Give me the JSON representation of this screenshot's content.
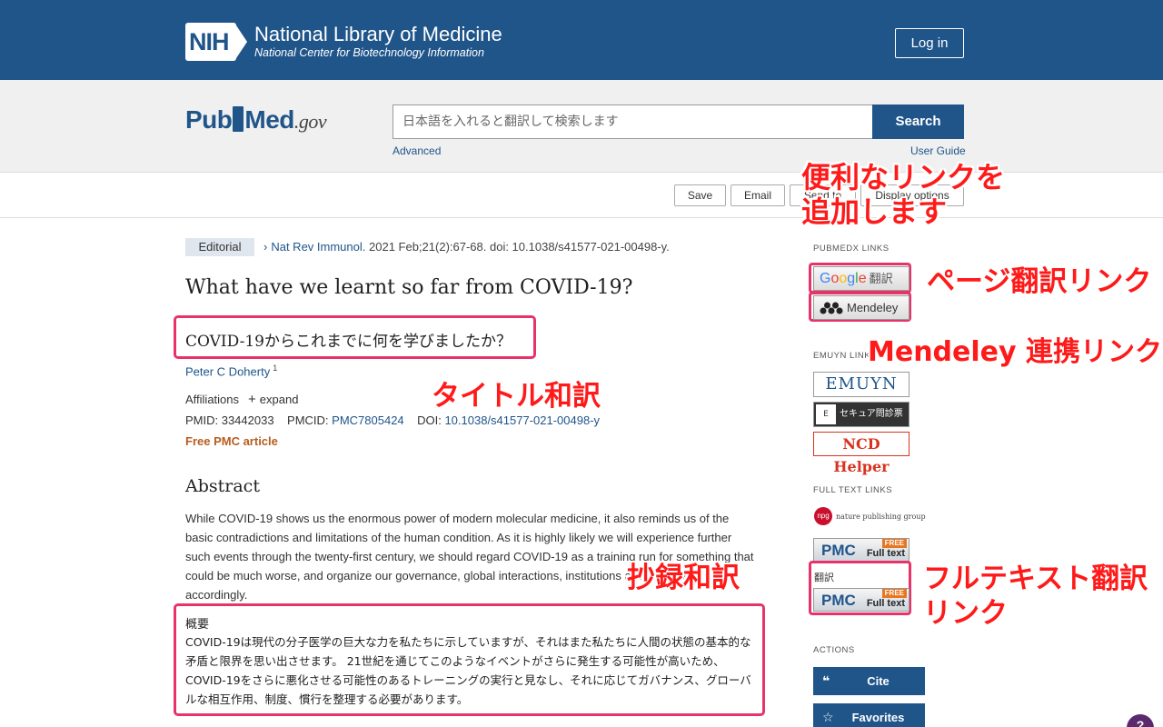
{
  "header": {
    "nih_badge": "NIH",
    "title": "National Library of Medicine",
    "subtitle": "National Center for Biotechnology Information",
    "login_label": "Log in"
  },
  "search": {
    "logo_pub": "Pub",
    "logo_med": "Med",
    "logo_gov": ".gov",
    "placeholder": "日本語を入れると翻訳して検索します",
    "button_label": "Search",
    "advanced_label": "Advanced",
    "guide_label": "User Guide"
  },
  "toolbar": {
    "save_label": "Save",
    "email_label": "Email",
    "send_label": "Send to",
    "display_label": "Display options"
  },
  "article": {
    "type_badge": "Editorial",
    "journal": "Nat Rev Immunol.",
    "citation": " 2021 Feb;21(2):67-68. doi: 10.1038/s41577-021-00498-y.",
    "title": "What have we learnt so far from COVID-19?",
    "title_jp": "COVID-19からこれまでに何を学びましたか？",
    "author": "Peter C Doherty",
    "author_sup": "1",
    "affiliations_label": "Affiliations",
    "expand_label": "expand",
    "pmid_label": "PMID: 33442033",
    "pmcid_label": "PMCID: ",
    "pmcid_value": "PMC7805424",
    "doi_label": "DOI: ",
    "doi_value": "10.1038/s41577-021-00498-y",
    "free_pmc": "Free PMC article",
    "abstract_heading": "Abstract",
    "abstract_text": "While COVID-19 shows us the enormous power of modern molecular medicine, it also reminds us of the basic contradictions and limitations of the human condition. As it is highly likely we will experience further such events through the twenty-first century, we should regard COVID-19 as a training run for something that could be much worse, and organize our governance, global interactions, institutions and practices accordingly.",
    "abstract_jp_heading": "概要",
    "abstract_jp_text": "COVID-19は現代の分子医学の巨大な力を私たちに示していますが、それはまた私たちに人間の状態の基本的な矛盾と限界を思い出させます。 21世紀を通じてこのようなイベントがさらに発生する可能性が高いため、COVID-19をさらに悪化させる可能性のあるトレーニングの実行と見なし、それに応じてガバナンス、グローバルな相互作用、制度、慣行を整理する必要があります。"
  },
  "sidebar": {
    "pubmedx_heading": "PUBMEDX LINKS",
    "google_jp": "翻訳",
    "mendeley_label": "Mendeley",
    "emuyn_heading": "EMUYN LINKS",
    "emuyn_label": "EMUYN",
    "secure_label": "セキュア問診票",
    "ncd_label": "NCD Helper",
    "fulltext_heading": "FULL TEXT LINKS",
    "npg_label": "nature publishing group",
    "pmc_label": "PMC",
    "pmc_free": "FREE",
    "pmc_fulltext": "Full text",
    "translate_label": "翻訳",
    "actions_heading": "ACTIONS",
    "cite_label": "Cite",
    "favorites_label": "Favorites"
  },
  "annotations": {
    "links_line1": "便利なリンクを",
    "links_line2": "追加します",
    "page_translate": "ページ翻訳リンク",
    "mendeley_link": "Mendeley 連携リンク",
    "title_translate": "タイトル和訳",
    "abstract_translate": "抄録和訳",
    "fulltext_line1": "フルテキスト翻訳",
    "fulltext_line2": "リンク"
  },
  "colors": {
    "nih_blue": "#20558a",
    "annotation_red": "#ff1a1a",
    "highlight_pink": "#e8336a"
  }
}
